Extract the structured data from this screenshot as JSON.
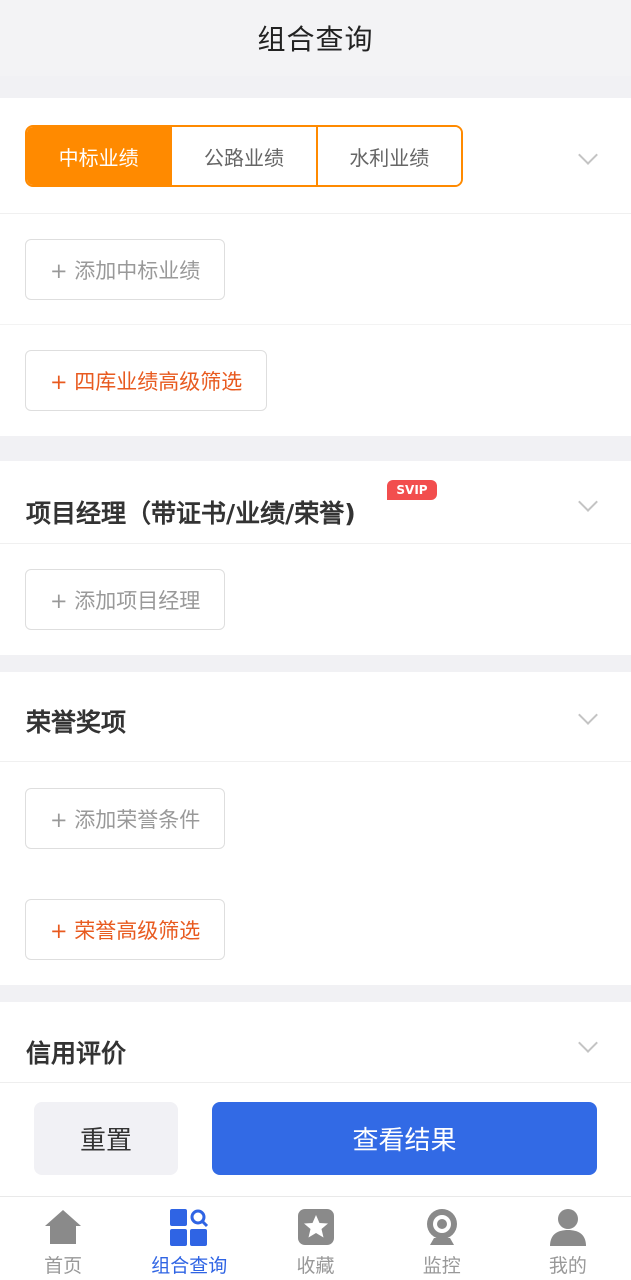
{
  "header": {
    "title": "组合查询"
  },
  "bid_section": {
    "tabs": [
      "中标业绩",
      "公路业绩",
      "水利业绩"
    ],
    "add_button": "+ 添加中标业绩",
    "advanced_button": "+ 四库业绩高级筛选"
  },
  "manager_section": {
    "title": "项目经理（带证书/业绩/荣誉)",
    "badge": "SVIP",
    "add_button": "+ 添加项目经理"
  },
  "honor_section": {
    "title": "荣誉奖项",
    "add_button": "+ 添加荣誉条件",
    "advanced_button": "+ 荣誉高级筛选"
  },
  "credit_section": {
    "title": "信用评价"
  },
  "actions": {
    "reset": "重置",
    "submit": "查看结果"
  },
  "tabbar": {
    "items": [
      {
        "label": "首页",
        "icon": "home-icon"
      },
      {
        "label": "组合查询",
        "icon": "combined-search-icon"
      },
      {
        "label": "收藏",
        "icon": "favorites-star-icon"
      },
      {
        "label": "监控",
        "icon": "monitor-camera-icon"
      },
      {
        "label": "我的",
        "icon": "profile-person-icon"
      }
    ],
    "active_index": 1
  },
  "colors": {
    "accent_orange": "#ff8a00",
    "primary_blue": "#326ae5",
    "badge_red": "#f24e4e",
    "advanced_text": "#e85a1f"
  }
}
